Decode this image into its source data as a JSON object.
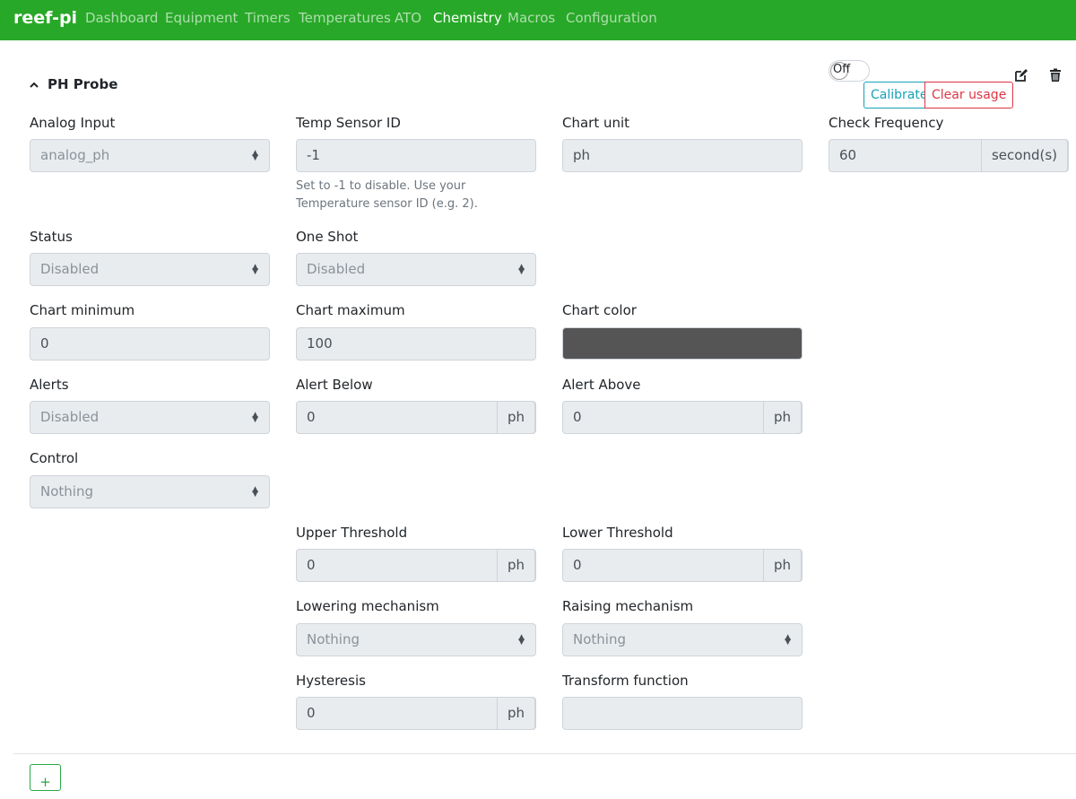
{
  "nav": {
    "brand": "reef-pi",
    "items": [
      "Dashboard",
      "Equipment",
      "Timers",
      "Temperatures",
      "ATO",
      "Chemistry",
      "Macros",
      "Configuration"
    ],
    "active": "Chemistry"
  },
  "probe": {
    "title": "PH Probe",
    "toggle_label": "Off",
    "calibrate_label": "Calibrate",
    "clear_usage_label": "Clear usage"
  },
  "form": {
    "analog_input_label": "Analog Input",
    "analog_input_value": "analog_ph",
    "temp_sensor_label": "Temp Sensor ID",
    "temp_sensor_value": "-1",
    "temp_sensor_help": "Set to -1 to disable. Use your Temperature sensor ID (e.g. 2).",
    "chart_unit_label": "Chart unit",
    "chart_unit_value": "ph",
    "check_frequency_label": "Check Frequency",
    "check_frequency_value": "60",
    "check_frequency_unit": "second(s)",
    "status_label": "Status",
    "status_value": "Disabled",
    "one_shot_label": "One Shot",
    "one_shot_value": "Disabled",
    "chart_min_label": "Chart minimum",
    "chart_min_value": "0",
    "chart_max_label": "Chart maximum",
    "chart_max_value": "100",
    "chart_color_label": "Chart color",
    "chart_color_value": "#555555",
    "alerts_label": "Alerts",
    "alerts_value": "Disabled",
    "alert_below_label": "Alert Below",
    "alert_below_value": "0",
    "alert_below_unit": "ph",
    "alert_above_label": "Alert Above",
    "alert_above_value": "0",
    "alert_above_unit": "ph",
    "control_label": "Control",
    "control_value": "Nothing",
    "upper_threshold_label": "Upper Threshold",
    "upper_threshold_value": "0",
    "upper_threshold_unit": "ph",
    "lower_threshold_label": "Lower Threshold",
    "lower_threshold_value": "0",
    "lower_threshold_unit": "ph",
    "lowering_label": "Lowering mechanism",
    "lowering_value": "Nothing",
    "raising_label": "Raising mechanism",
    "raising_value": "Nothing",
    "hysteresis_label": "Hysteresis",
    "hysteresis_value": "0",
    "hysteresis_unit": "ph",
    "transform_label": "Transform function",
    "transform_value": ""
  },
  "footer": {
    "add_label": "+"
  },
  "icons": {
    "edit": "edit-icon",
    "delete": "trash-icon",
    "collapse": "chevron-up-icon",
    "select": "select-arrows-icon"
  },
  "colors": {
    "navbar": "#28a828",
    "calibrate": "#17a2b8",
    "clear": "#dc3545",
    "add": "#28a745"
  }
}
